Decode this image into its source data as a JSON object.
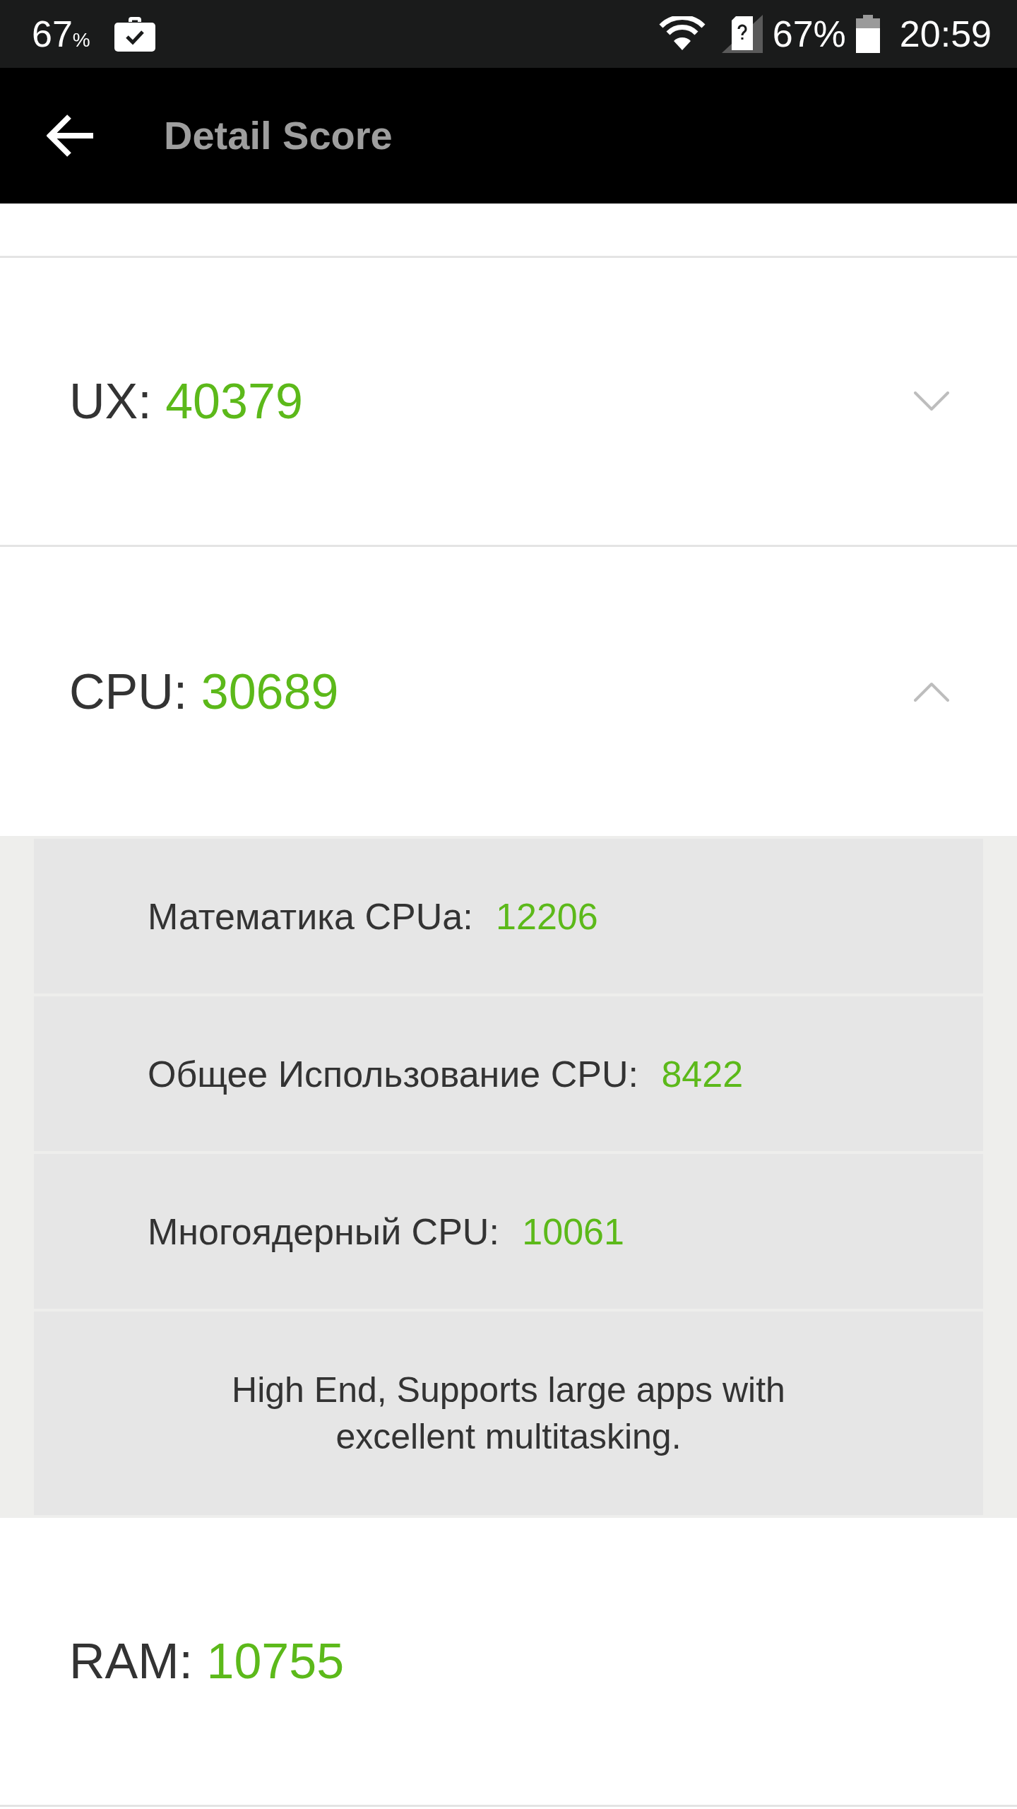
{
  "status_bar": {
    "indicator_value": "67",
    "indicator_unit": "%",
    "battery_percent": "67%",
    "time": "20:59"
  },
  "app_bar": {
    "title": "Detail Score"
  },
  "sections": [
    {
      "label": "UX:",
      "score": "40379",
      "expanded": false
    },
    {
      "label": "CPU:",
      "score": "30689",
      "expanded": true,
      "details": [
        {
          "label": "Математика CPUa:",
          "score": "12206"
        },
        {
          "label": "Общее Использование CPU:",
          "score": "8422"
        },
        {
          "label": "Многоядерный CPU:",
          "score": "10061"
        }
      ],
      "summary": "High End, Supports large apps with excellent multitasking."
    },
    {
      "label": "RAM:",
      "score": "10755"
    }
  ]
}
